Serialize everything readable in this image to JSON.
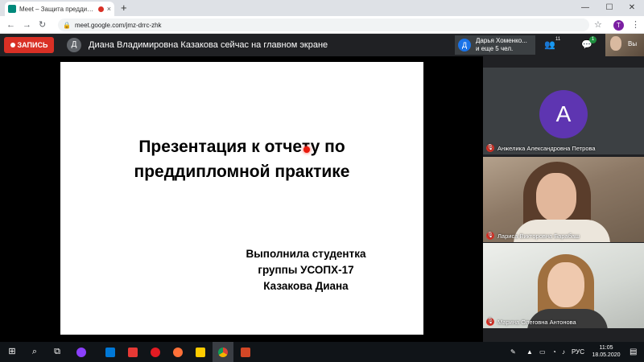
{
  "browser": {
    "tab_title": "Meet – Защита предди…",
    "tab_close": "×",
    "new_tab": "+",
    "url": "meet.google.com/jmz-drrc-zhk",
    "profile_letter": "T",
    "window_controls": [
      "—",
      "☐",
      "✕"
    ]
  },
  "meet": {
    "record_label": "ЗАПИСЬ",
    "presenter_initial": "Д",
    "presenter_text": "Диана Владимировна Казакова сейчас на главном экране",
    "participants_preview": {
      "initial": "Д",
      "line1": "Дарья Хоменко...",
      "line2": "и еще 5 чел."
    },
    "people_count": "11",
    "chat_badge": "1",
    "self_label": "Вы"
  },
  "slide": {
    "title_line1": "Презентация к отчету по",
    "title_line2": "преддипломной практике",
    "author_line1": "Выполнила студентка",
    "author_line2": "группы УСОПХ-17",
    "author_line3": "Казакова Диана"
  },
  "participants": [
    {
      "initial": "А",
      "name": "Анжелика Александровна Петрова",
      "avatar_color": "#5e35b1"
    },
    {
      "name": "Лариса Викторовна Барабаш"
    },
    {
      "name": "Марина Олеговна Антонова"
    }
  ],
  "taskbar": {
    "language": "РУС",
    "time": "11:05",
    "date": "18.05.2020"
  },
  "colors": {
    "record_red": "#d93025",
    "meet_dark": "#202124",
    "laser_pointer": "#e8190c"
  }
}
